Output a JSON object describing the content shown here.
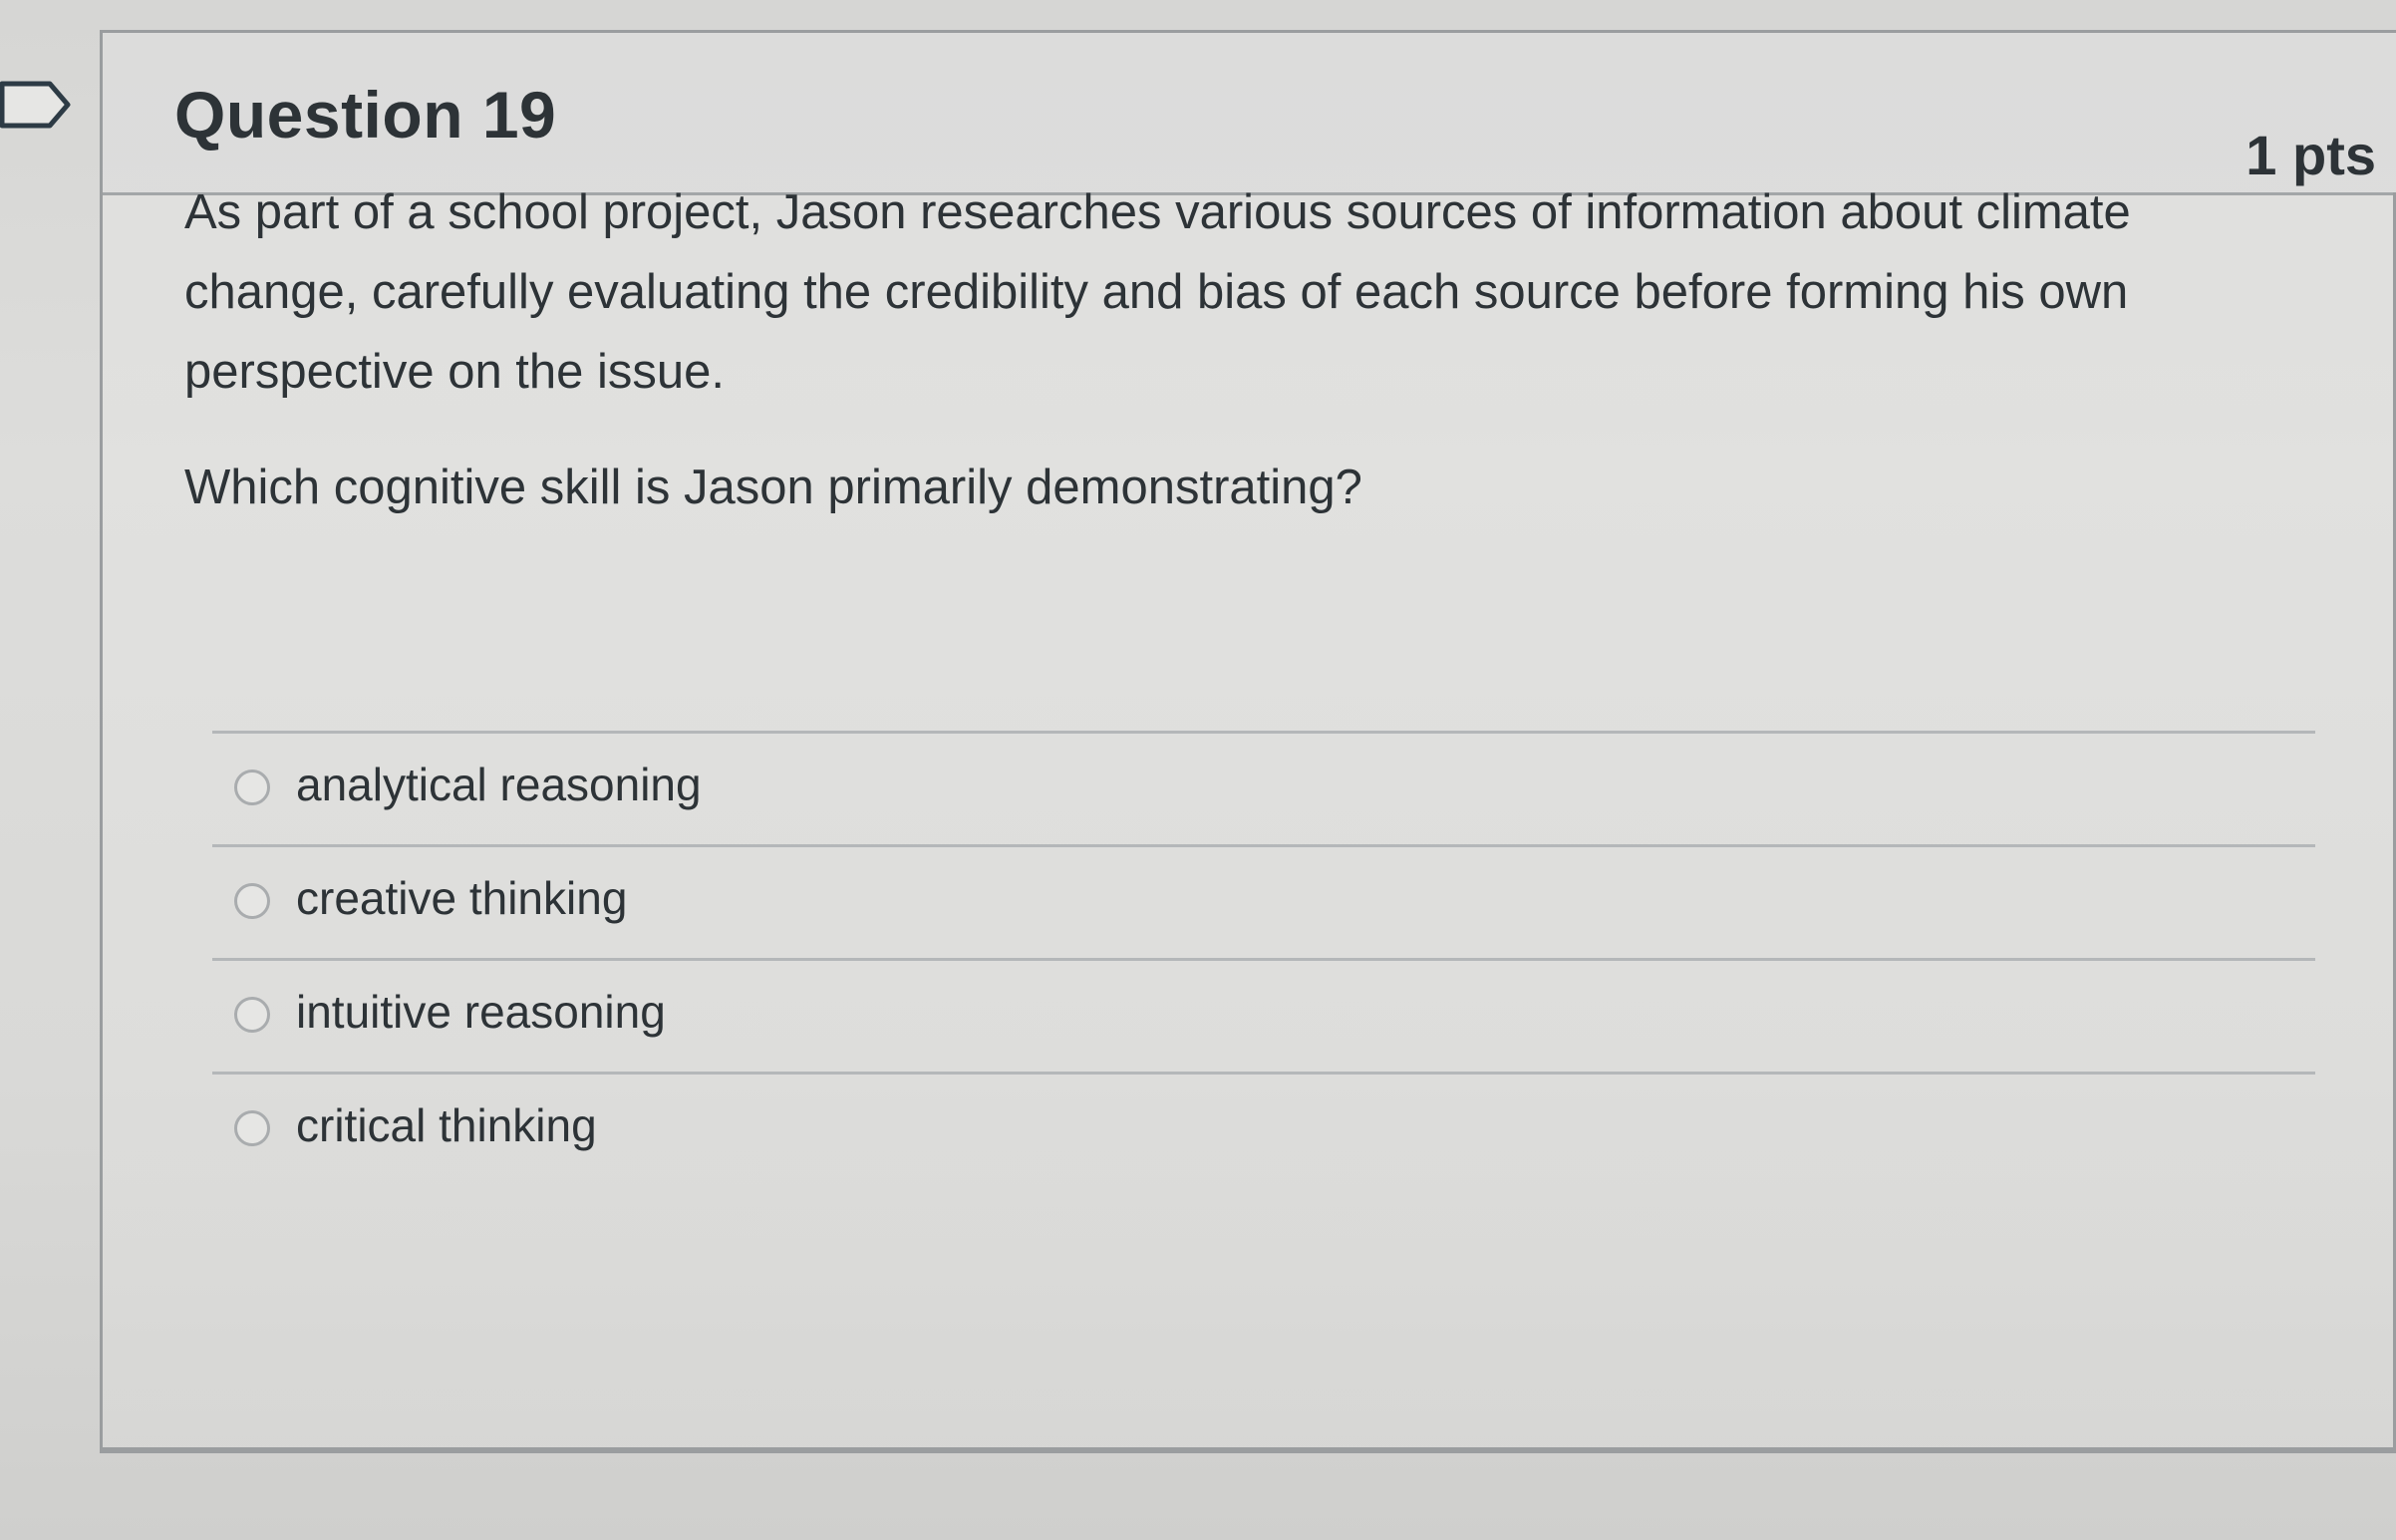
{
  "question": {
    "title": "Question 19",
    "points": "1 pts",
    "prompt": [
      "As part of a school project, Jason researches various sources of information about climate change, carefully evaluating the credibility and bias of each source before forming his own perspective on the issue.",
      "Which cognitive skill is Jason primarily demonstrating?"
    ],
    "answers": [
      "analytical reasoning",
      "creative thinking",
      "intuitive reasoning",
      "critical thinking"
    ]
  }
}
